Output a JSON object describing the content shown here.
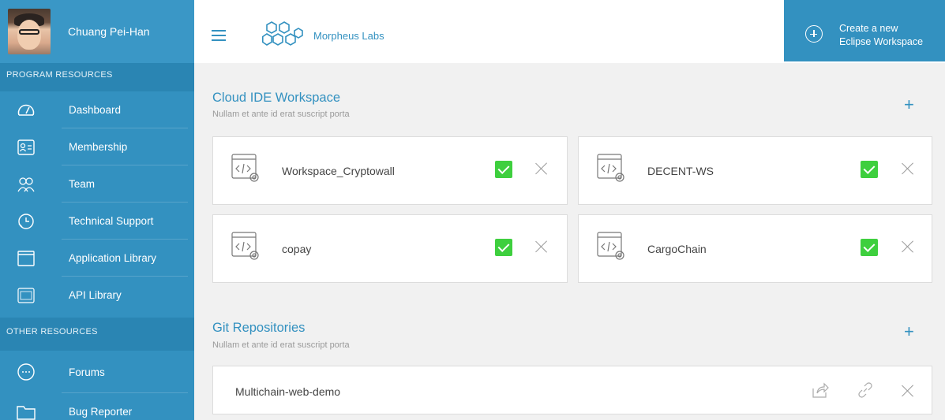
{
  "profile": {
    "name": "Chuang Pei-Han"
  },
  "sidebar": {
    "program_header": "PROGRAM RESOURCES",
    "program_items": [
      {
        "label": "Dashboard",
        "icon": "gauge-icon"
      },
      {
        "label": "Membership",
        "icon": "id-card-icon"
      },
      {
        "label": "Team",
        "icon": "team-icon"
      },
      {
        "label": "Technical Support",
        "icon": "support-icon"
      },
      {
        "label": "Application Library",
        "icon": "window-icon"
      },
      {
        "label": "API Library",
        "icon": "api-icon"
      }
    ],
    "other_header": "OTHER RESOURCES",
    "other_items": [
      {
        "label": "Forums",
        "icon": "chat-bubble-icon"
      },
      {
        "label": "Bug Reporter",
        "icon": "folder-icon"
      }
    ]
  },
  "topbar": {
    "brand": "Morpheus Labs",
    "create_line1": "Create a new",
    "create_line2": "Eclipse Workspace"
  },
  "workspace_section": {
    "title": "Cloud IDE Workspace",
    "subtitle": "Nullam et ante id erat suscript porta",
    "items": [
      {
        "name": "Workspace_Cryptowall"
      },
      {
        "name": "DECENT-WS"
      },
      {
        "name": "copay"
      },
      {
        "name": "CargoChain"
      }
    ]
  },
  "repo_section": {
    "title": "Git Repositories",
    "subtitle": "Nullam et ante id erat suscript porta",
    "items": [
      {
        "name": "Multichain-web-demo"
      }
    ]
  },
  "colors": {
    "primary": "#3391c0",
    "success": "#3ecf3e",
    "background": "#f1f1f1"
  }
}
